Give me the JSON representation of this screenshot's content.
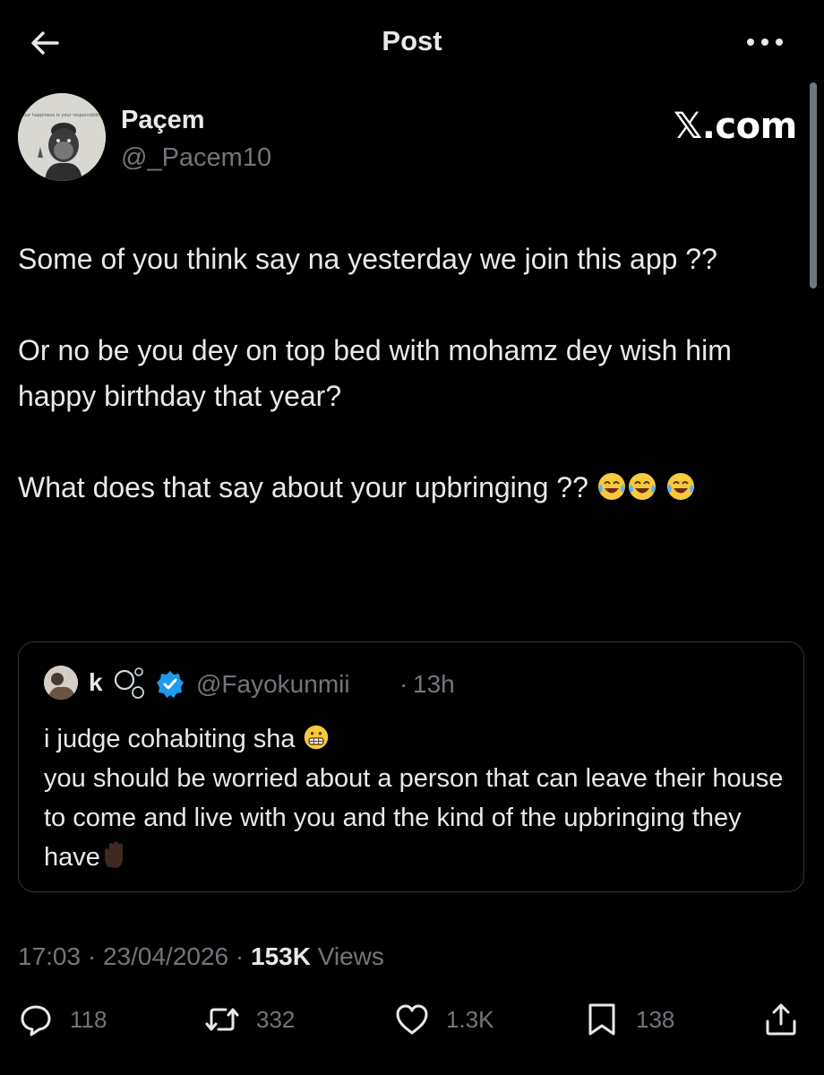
{
  "header": {
    "title": "Post",
    "back_icon": "arrow-left-icon",
    "more_icon": "more-horizontal-icon"
  },
  "author": {
    "name": "Paçem",
    "handle": "@_Pacem10",
    "avatar_caption": "Your happiness is your responsibility"
  },
  "watermark": "𝕏.com",
  "post": {
    "line1": "Some of you think say na yesterday we join this app ??",
    "line2": "Or no be you dey on top bed with mohamz dey wish him happy birthday that year?",
    "line3": "What does that say about your upbringing ??"
  },
  "quote": {
    "name": "k",
    "handle": "@Fayokunmii",
    "separator": "·",
    "time": "13h",
    "line1": "i judge cohabiting sha",
    "line2": "you should be worried about a person that can leave their house to come and live with you and the kind of the upbringing they have"
  },
  "meta": {
    "time": "17:03",
    "date": "23/04/2026",
    "sep": "·",
    "views_count": "153K",
    "views_label": "Views"
  },
  "actions": {
    "replies": "118",
    "reposts": "332",
    "likes": "1.3K",
    "bookmarks": "138"
  },
  "colors": {
    "background": "#000000",
    "text": "#e7e9ea",
    "muted": "#71767b",
    "border": "#2f3336",
    "verified": "#1d9bf0"
  }
}
